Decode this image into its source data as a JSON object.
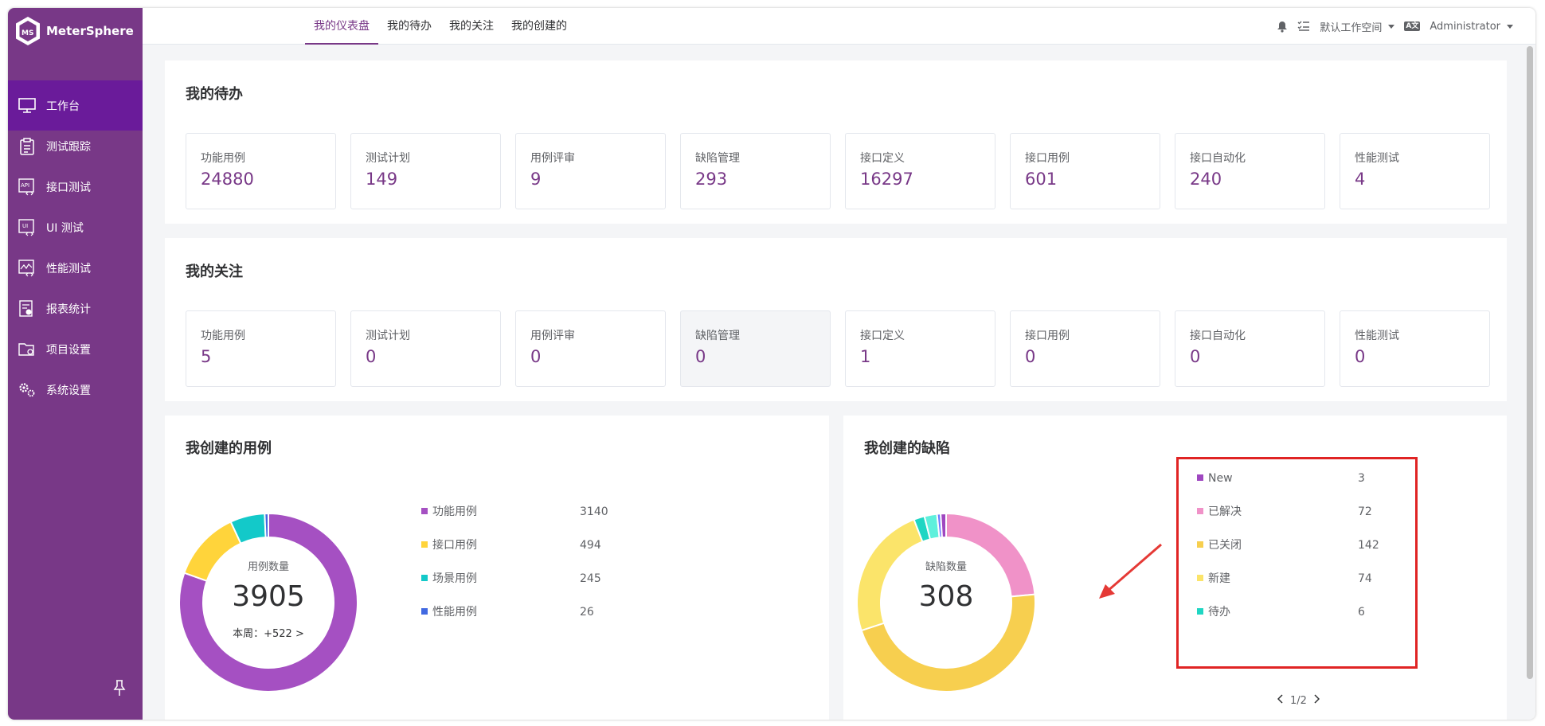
{
  "app": {
    "name": "MeterSphere"
  },
  "sidebar": {
    "items": [
      {
        "label": "工作台",
        "icon": "monitor-icon",
        "active": true
      },
      {
        "label": "测试跟踪",
        "icon": "clipboard-icon"
      },
      {
        "label": "接口测试",
        "icon": "api-icon"
      },
      {
        "label": "UI 测试",
        "icon": "ui-icon"
      },
      {
        "label": "性能测试",
        "icon": "performance-icon"
      },
      {
        "label": "报表统计",
        "icon": "report-icon"
      },
      {
        "label": "项目设置",
        "icon": "folder-settings-icon"
      },
      {
        "label": "系统设置",
        "icon": "gears-icon"
      }
    ]
  },
  "header": {
    "tabs": [
      "我的仪表盘",
      "我的待办",
      "我的关注",
      "我的创建的"
    ],
    "active_tab": "我的仪表盘",
    "workspace": "默认工作空间",
    "lang_icon_text": "A文",
    "user": "Administrator"
  },
  "todo": {
    "title": "我的待办",
    "cards": [
      {
        "label": "功能用例",
        "value": "24880"
      },
      {
        "label": "测试计划",
        "value": "149"
      },
      {
        "label": "用例评审",
        "value": "9"
      },
      {
        "label": "缺陷管理",
        "value": "293"
      },
      {
        "label": "接口定义",
        "value": "16297"
      },
      {
        "label": "接口用例",
        "value": "601"
      },
      {
        "label": "接口自动化",
        "value": "240"
      },
      {
        "label": "性能测试",
        "value": "4"
      }
    ]
  },
  "follow": {
    "title": "我的关注",
    "cards": [
      {
        "label": "功能用例",
        "value": "5"
      },
      {
        "label": "测试计划",
        "value": "0"
      },
      {
        "label": "用例评审",
        "value": "0"
      },
      {
        "label": "缺陷管理",
        "value": "0"
      },
      {
        "label": "接口定义",
        "value": "1"
      },
      {
        "label": "接口用例",
        "value": "0"
      },
      {
        "label": "接口自动化",
        "value": "0"
      },
      {
        "label": "性能测试",
        "value": "0"
      }
    ]
  },
  "cases": {
    "title": "我创建的用例",
    "center_label": "用例数量",
    "total": "3905",
    "week_text": "本周：+522 >"
  },
  "bugs": {
    "title": "我创建的缺陷",
    "center_label": "缺陷数量",
    "total": "308",
    "pager": "1/2"
  },
  "chart_data": [
    {
      "type": "pie",
      "title": "我创建的用例",
      "categories": [
        "功能用例",
        "接口用例",
        "场景用例",
        "性能用例"
      ],
      "values": [
        3140,
        494,
        245,
        26
      ],
      "colors": [
        "#a550c2",
        "#ffd43b",
        "#13c9c9",
        "#4169e1"
      ]
    },
    {
      "type": "pie",
      "title": "我创建的缺陷",
      "categories": [
        "New",
        "已解决",
        "已关闭",
        "新建",
        "待办"
      ],
      "values": [
        3,
        72,
        142,
        74,
        6
      ],
      "colors": [
        "#9f47c0",
        "#f092c8",
        "#f7cf4f",
        "#fbe46a",
        "#1fd6c3"
      ],
      "extra_slices": [
        {
          "value": 7,
          "color": "#5ef0dc"
        },
        {
          "value": 2,
          "color": "#6d7bff"
        },
        {
          "value": 2,
          "color": "#b07bff"
        }
      ]
    }
  ],
  "colors": {
    "brand": "#783887",
    "highlight_box": "#e02424",
    "arrow": "#e53935"
  }
}
